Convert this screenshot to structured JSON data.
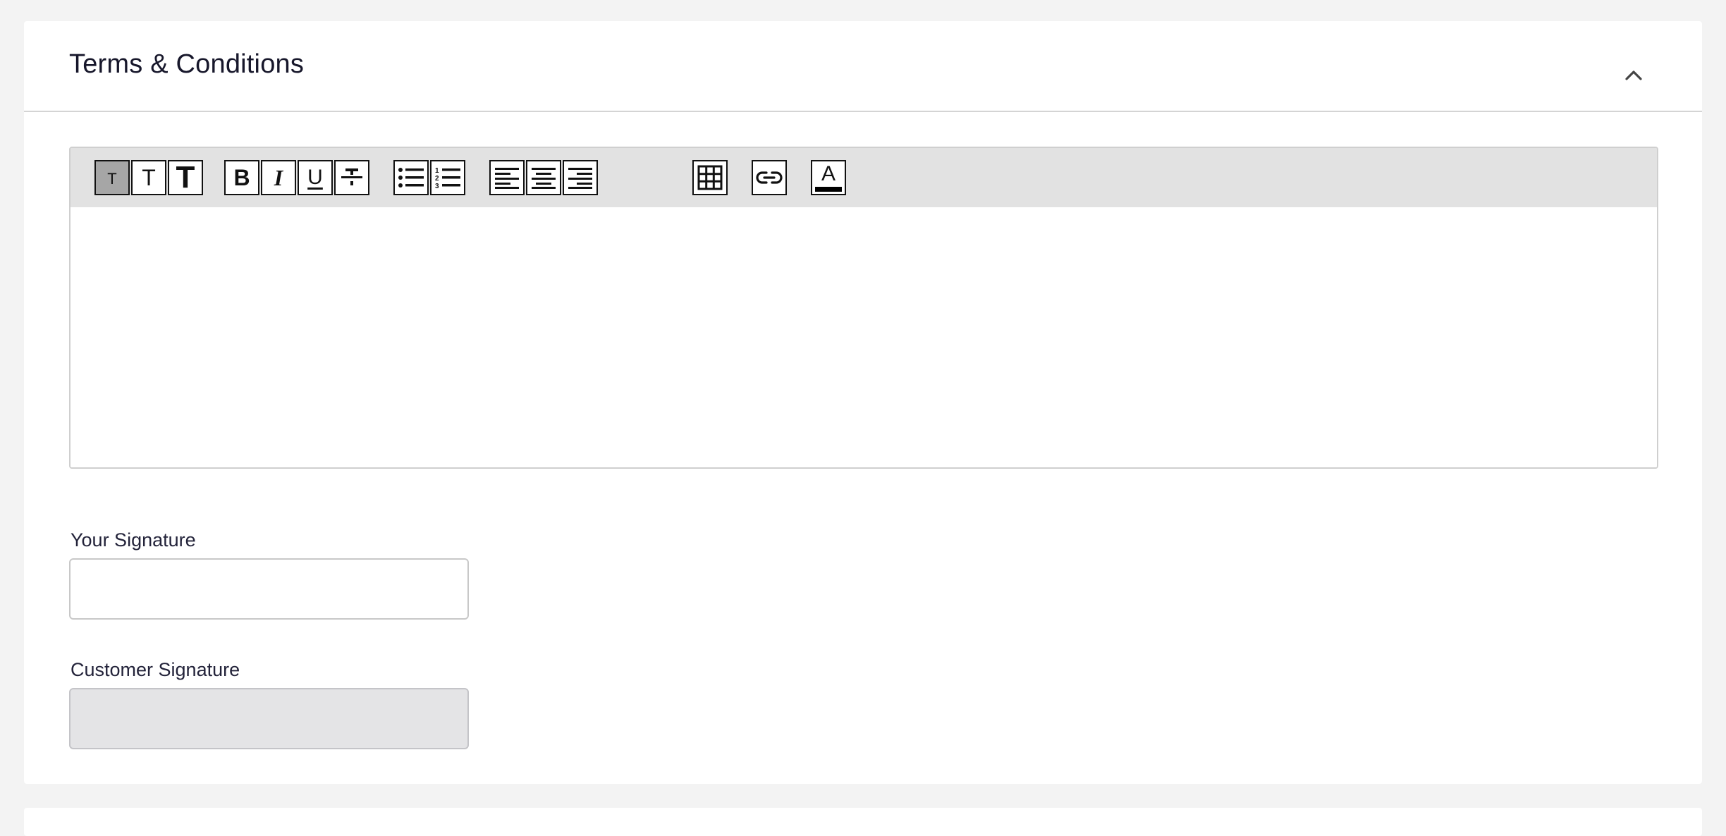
{
  "section": {
    "title": "Terms & Conditions",
    "collapse_icon": "chevron-up-icon"
  },
  "editor": {
    "toolbar": [
      {
        "name": "text-size-small-icon",
        "glyph": "T",
        "active": true
      },
      {
        "name": "text-size-medium-icon",
        "glyph": "T",
        "active": false
      },
      {
        "name": "text-size-large-icon",
        "glyph": "T",
        "active": false
      },
      {
        "name": "bold-icon",
        "glyph": "B",
        "active": false
      },
      {
        "name": "italic-icon",
        "glyph": "I",
        "active": false
      },
      {
        "name": "underline-icon",
        "glyph": "U",
        "active": false
      },
      {
        "name": "strikethrough-icon",
        "glyph": "T",
        "active": false
      },
      {
        "name": "bulleted-list-icon",
        "active": false
      },
      {
        "name": "numbered-list-icon",
        "active": false
      },
      {
        "name": "align-left-icon",
        "active": false
      },
      {
        "name": "align-center-icon",
        "active": false
      },
      {
        "name": "align-right-icon",
        "active": false
      },
      {
        "name": "table-icon",
        "active": false
      },
      {
        "name": "link-icon",
        "active": false
      },
      {
        "name": "text-color-icon",
        "glyph": "A",
        "active": false
      }
    ],
    "content": ""
  },
  "your_signature": {
    "label": "Your Signature",
    "value": ""
  },
  "customer_signature": {
    "label": "Customer Signature",
    "value": ""
  },
  "colors": {
    "background": "#f3f3f3",
    "card": "#ffffff",
    "toolbar": "#e2e2e2",
    "active_button": "#a6a6a6",
    "disabled_field": "#e4e4e6"
  }
}
